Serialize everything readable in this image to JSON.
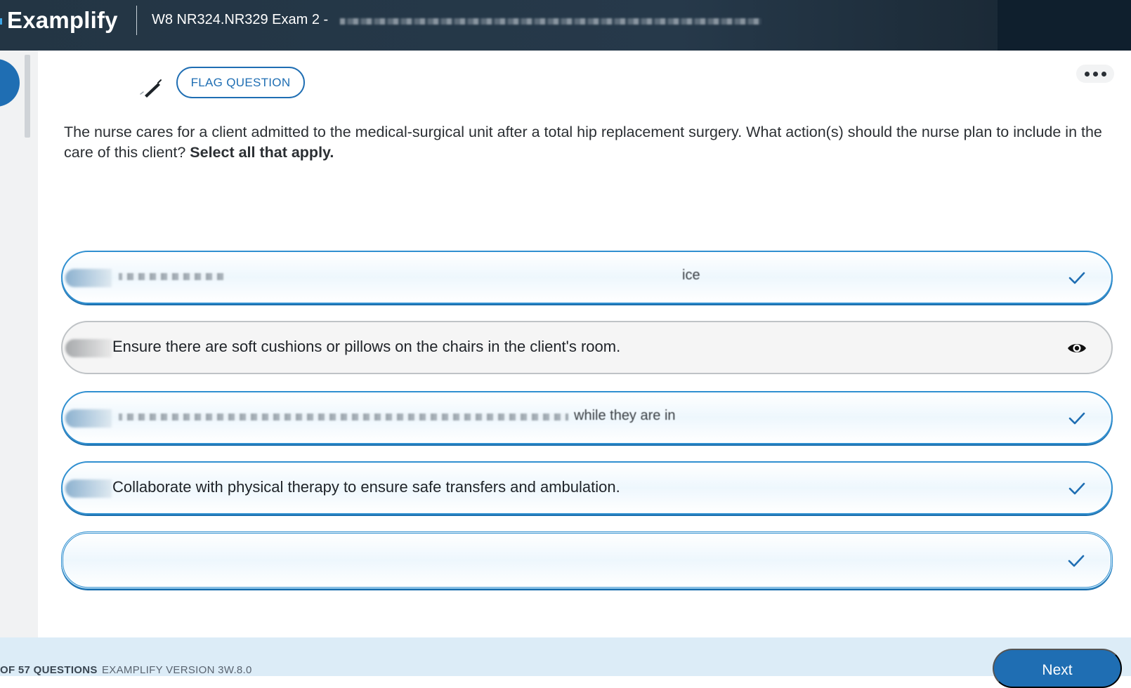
{
  "header": {
    "brand": "Examplify",
    "exam_title": "W8 NR324.NR329 Exam 2 -"
  },
  "toolbar": {
    "flag_label": "FLAG QUESTION",
    "highlighter_icon": "highlighter-pen-icon",
    "more_icon": "more-options-icon"
  },
  "question": {
    "text": "The nurse cares for a client admitted to the medical-surgical unit after a total hip replacement surgery. What action(s) should the nurse plan to include in the care of this client?",
    "instruction": "Select all that apply."
  },
  "options": [
    {
      "text": "",
      "tail": "ice",
      "state": "selected",
      "icon": "checkmark-icon"
    },
    {
      "text": "Ensure there are soft cushions or pillows on the chairs in the client's room.",
      "tail": "",
      "state": "eliminated",
      "icon": "eye-icon"
    },
    {
      "text": "",
      "tail": "while they are in",
      "state": "selected",
      "icon": "checkmark-icon"
    },
    {
      "text": "Collaborate with physical therapy to ensure safe transfers and ambulation.",
      "tail": "",
      "state": "selected",
      "icon": "checkmark-icon"
    },
    {
      "text": "",
      "tail": "",
      "state": "selected",
      "icon": "checkmark-icon"
    }
  ],
  "footer": {
    "question_count": "OF 57 QUESTIONS",
    "version": "EXAMPLIFY VERSION 3W.8.0",
    "next_label": "Next"
  },
  "colors": {
    "primary": "#1f6eb3",
    "header_bg": "#233544",
    "selected_border": "#2f8fd0",
    "footer_bg": "#dcecf7"
  }
}
